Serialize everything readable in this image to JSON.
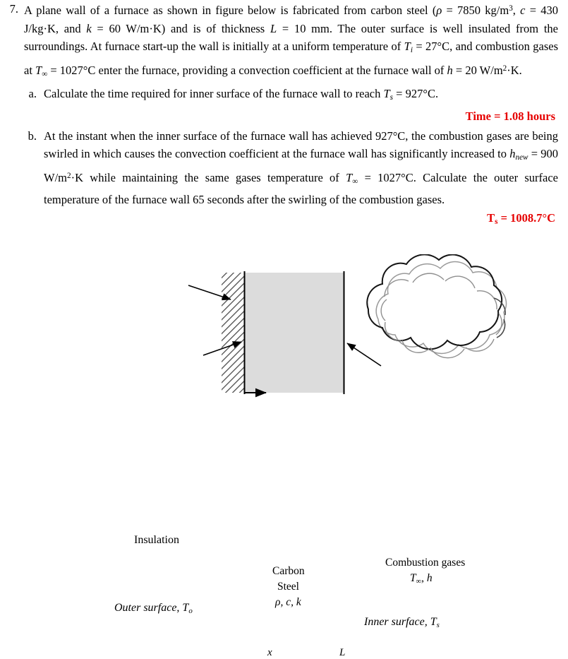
{
  "document": {
    "question_number": "7.",
    "stem_parts": {
      "p1": "A plane wall of a furnace as shown in figure below is fabricated from carbon steel (",
      "rho": "ρ",
      "p2": " = 7850 kg/m",
      "sup3": "3",
      "p3": ", ",
      "c": "c",
      "p4": " = 430 J/kg·K, and ",
      "k": "k",
      "p5": " = 60 W/m·K) and is of thickness ",
      "L": "L",
      "p6": " = 10 mm. The outer surface is well insulated from the surroundings. At furnace start-up the wall is initially at a uniform temperature of ",
      "Ti": "T",
      "Ti_sub": "i",
      "p7": " = 27°C, and combustion gases at ",
      "Tinf": "T",
      "Tinf_sub": "∞",
      "p8": " = 1027°C enter the furnace, providing a convection coefficient at the furnace wall of ",
      "h": "h",
      "p9": " = 20 W/m",
      "sup2": "2",
      "p10": "·K."
    },
    "parts": [
      {
        "letter": "a.",
        "text_1": "Calculate the time required for inner surface of the furnace wall to reach ",
        "sym_T": "T",
        "sym_sub": "s",
        "text_2": " = 927°C.",
        "answer": "Time = 1.08 hours"
      },
      {
        "letter": "b.",
        "text_1": "At the instant when the inner surface of the furnace wall has achieved 927°C, the combustion gases are being swirled in which causes the convection coefficient at the furnace wall has significantly increased to ",
        "sym_h": "h",
        "sym_h_sub": "new",
        "text_2": " = 900 W/m",
        "sup2": "2",
        "text_3": "·K while maintaining the same gases temperature of ",
        "sym_T": "T",
        "sym_T_sub": "∞",
        "text_4": " = 1027°C.  Calculate the outer surface temperature of the furnace wall 65 seconds after the swirling of the combustion gases.",
        "answer": "Tₛ = 1008.7°C"
      }
    ],
    "answer_b_parts": {
      "symbol": "T",
      "subscript": "s",
      "value": " = 1008.7°C"
    }
  },
  "figure": {
    "labels": {
      "insulation": "Insulation",
      "outer_surface": "Outer surface, T",
      "outer_surface_sub": "o",
      "carbon": "Carbon",
      "steel": "Steel",
      "properties": "ρ, c, k",
      "combustion_gases": "Combustion gases",
      "gas_props": "T",
      "gas_props_sub": "∞",
      "gas_props_2": ", h",
      "inner_surface": "Inner surface, T",
      "inner_surface_sub": "s",
      "axis_x": "x",
      "axis_L": "L"
    },
    "colors": {
      "wall_fill": "#dcdcdc",
      "wall_stroke": "#000000",
      "hatch_stroke": "#555555",
      "cloud_stroke": "#1a1a1a",
      "cloud_inner_stroke": "#8c8c8c"
    }
  },
  "theme": {
    "answer_red": "#e60000",
    "text_black": "#000000",
    "page_background": "#ffffff"
  }
}
